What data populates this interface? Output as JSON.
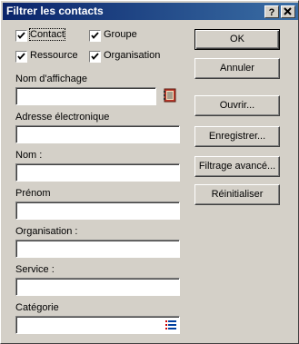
{
  "window": {
    "title": "Filtrer les contacts",
    "help_button": "?",
    "close_button": "x"
  },
  "filters": {
    "contact": {
      "label": "Contact",
      "checked": true
    },
    "groupe": {
      "label": "Groupe",
      "checked": true
    },
    "ressource": {
      "label": "Ressource",
      "checked": true
    },
    "organisation": {
      "label": "Organisation",
      "checked": true
    }
  },
  "fields": {
    "display_name": {
      "label": "Nom d'affichage",
      "value": ""
    },
    "email": {
      "label": "Adresse électronique",
      "value": ""
    },
    "nom": {
      "label": "Nom :",
      "value": ""
    },
    "prenom": {
      "label": "Prénom",
      "value": ""
    },
    "organisation": {
      "label": "Organisation :",
      "value": ""
    },
    "service": {
      "label": "Service :",
      "value": ""
    },
    "categorie": {
      "label": "Catégorie",
      "value": ""
    }
  },
  "buttons": {
    "ok": "OK",
    "annuler": "Annuler",
    "ouvrir": "Ouvrir...",
    "enregistrer": "Enregistrer...",
    "filtrage_avance": "Filtrage avancé...",
    "reinitialiser": "Réinitialiser"
  },
  "icons": {
    "address_book": "address-book-icon",
    "category_list": "list-icon"
  }
}
